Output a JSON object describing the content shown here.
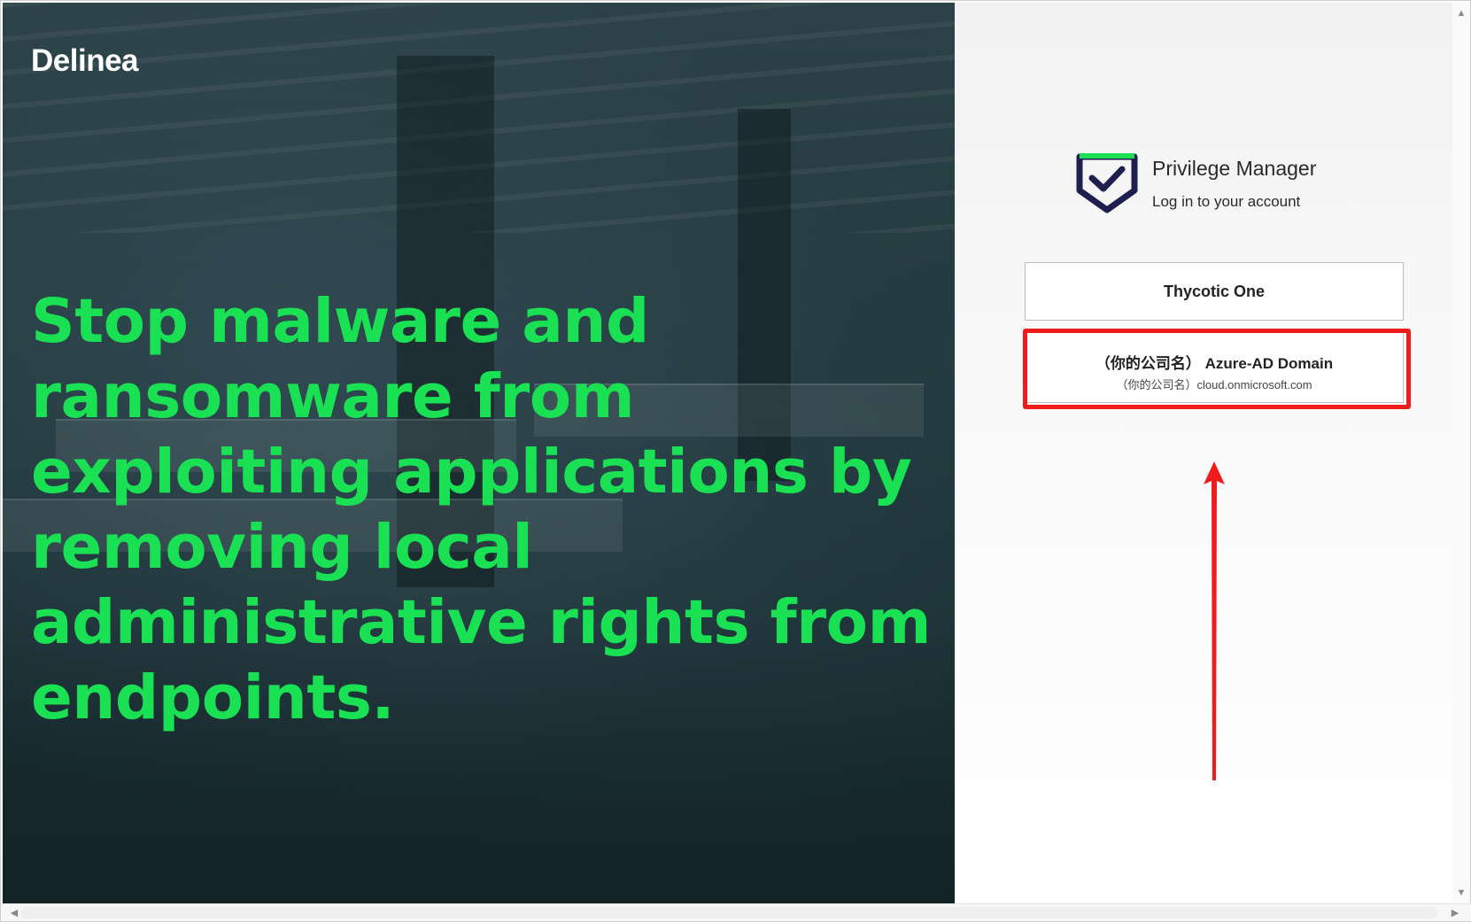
{
  "hero": {
    "logo_text": "Delinea",
    "headline": "Stop malware and ransomware from exploiting applications by removing local administrative rights from endpoints."
  },
  "login": {
    "product_icon": "shield-check-icon",
    "product_title": "Privilege Manager",
    "product_subtitle": "Log in to your account",
    "providers": [
      {
        "label": "Thycotic One"
      },
      {
        "label": "（你的公司名） Azure-AD Domain",
        "sublabel": "（你的公司名）cloud.onmicrosoft.com"
      }
    ]
  },
  "annotation": {
    "highlight_color": "#ee1c1c",
    "arrow_color": "#ee1c1c"
  },
  "colors": {
    "headline_green": "#19e153",
    "icon_navy": "#1e1e4f",
    "icon_green": "#19e153"
  }
}
